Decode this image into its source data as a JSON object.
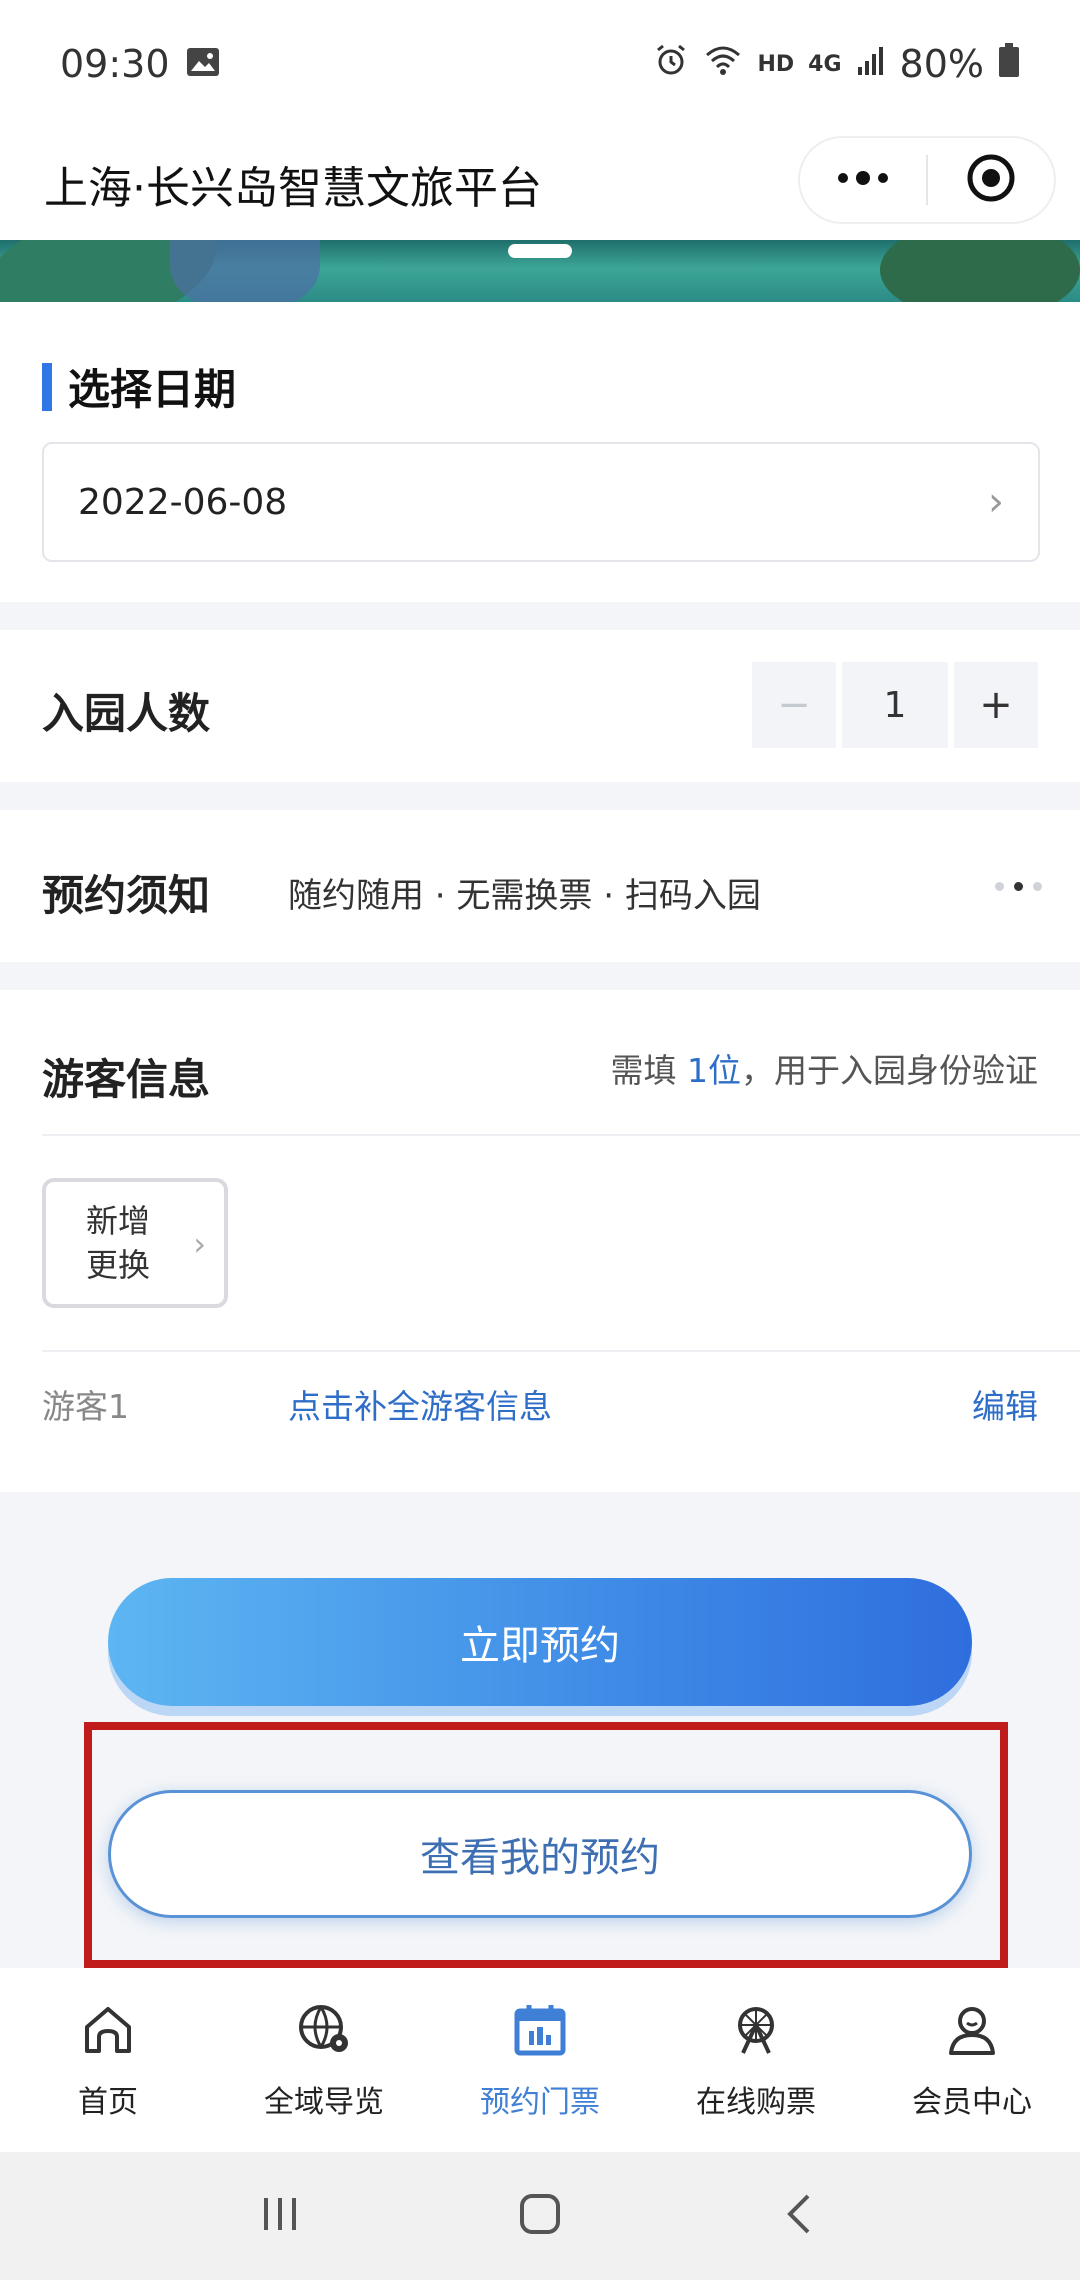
{
  "status_bar": {
    "time": "09:30",
    "network": "HD",
    "signal": "4G",
    "battery": "80%"
  },
  "header": {
    "title": "上海·长兴岛智慧文旅平台"
  },
  "date_section": {
    "title": "选择日期",
    "date_value": "2022-06-08"
  },
  "count_section": {
    "label": "入园人数",
    "decrement": "−",
    "value": "1",
    "increment": "+"
  },
  "notice_section": {
    "label": "预约须知",
    "text": "随约随用 · 无需换票 · 扫码入园"
  },
  "visitor_section": {
    "label": "游客信息",
    "hint_prefix": "需填",
    "hint_count": "1位",
    "hint_suffix": "，用于入园身份验证",
    "add_line1": "新增",
    "add_line2": "更换",
    "visitor_name": "游客1",
    "fill_link": "点击补全游客信息",
    "edit_link": "编辑"
  },
  "actions": {
    "book_now": "立即预约",
    "my_booking": "查看我的预约"
  },
  "tabbar": {
    "items": [
      {
        "label": "首页",
        "icon": "home-icon"
      },
      {
        "label": "全域导览",
        "icon": "globe-location-icon"
      },
      {
        "label": "预约门票",
        "icon": "calendar-icon",
        "active": true
      },
      {
        "label": "在线购票",
        "icon": "ferris-wheel-icon"
      },
      {
        "label": "会员中心",
        "icon": "user-icon"
      }
    ]
  },
  "colors": {
    "accent": "#3f7fd5",
    "highlight_border": "#c11c1c",
    "link": "#2f6ec8"
  }
}
